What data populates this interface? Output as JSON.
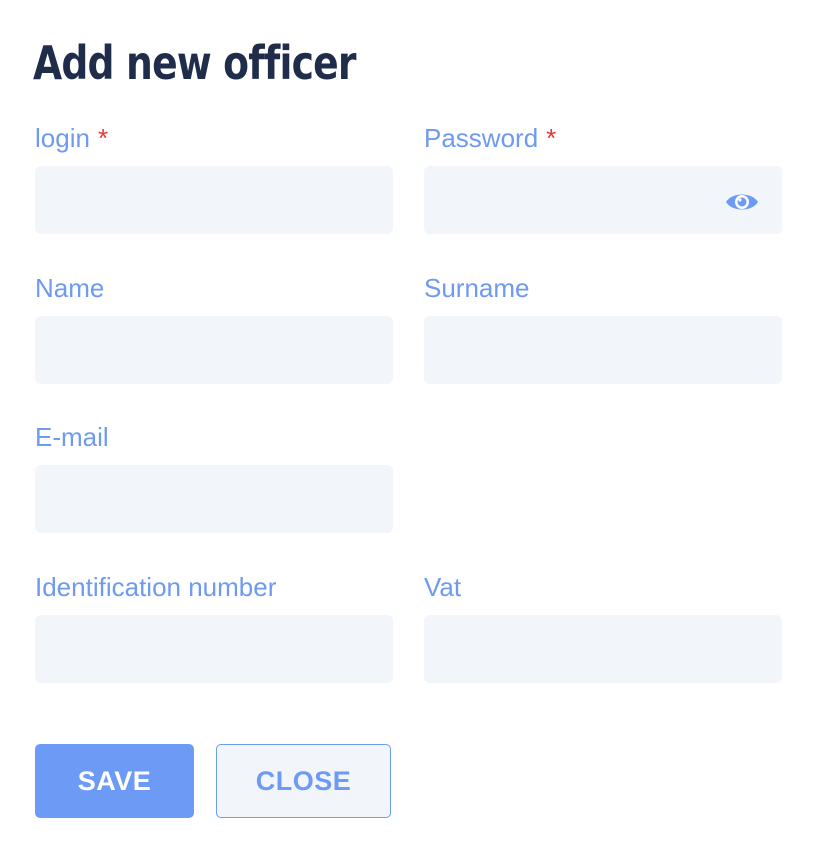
{
  "title": "Add new officer",
  "fields": {
    "login": {
      "label": "login",
      "required_mark": "*",
      "value": ""
    },
    "password": {
      "label": "Password",
      "required_mark": "*",
      "value": "",
      "icon": "eye-icon"
    },
    "name": {
      "label": "Name",
      "value": ""
    },
    "surname": {
      "label": "Surname",
      "value": ""
    },
    "email": {
      "label": "E-mail",
      "value": ""
    },
    "identification_number": {
      "label": "Identification number",
      "value": ""
    },
    "vat": {
      "label": "Vat",
      "value": ""
    }
  },
  "buttons": {
    "save": "SAVE",
    "close": "CLOSE"
  },
  "colors": {
    "accent": "#6d9af5",
    "label": "#6e9af0",
    "title": "#1f2d4a",
    "required": "#e53935",
    "input_bg": "#f2f5fa"
  }
}
